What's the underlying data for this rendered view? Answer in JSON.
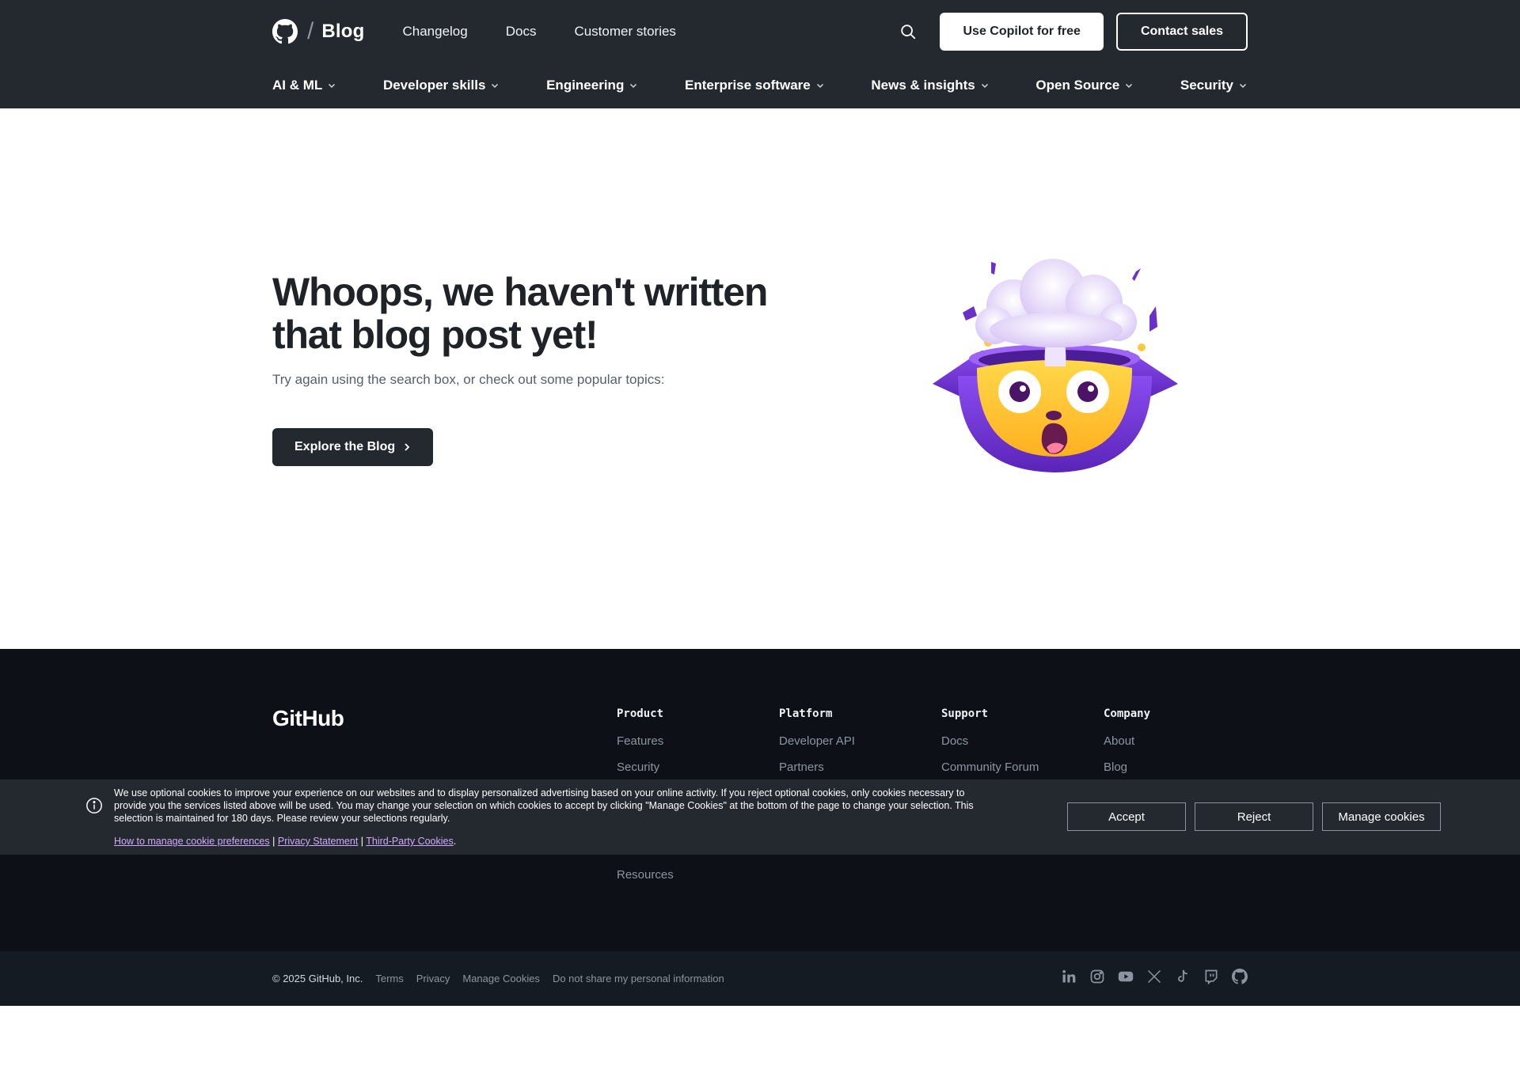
{
  "header": {
    "brand": "Blog",
    "top_links": [
      "Changelog",
      "Docs",
      "Customer stories"
    ],
    "copilot_button": "Use Copilot for free",
    "sales_button": "Contact sales",
    "categories": [
      "AI & ML",
      "Developer skills",
      "Engineering",
      "Enterprise software",
      "News & insights",
      "Open Source",
      "Security"
    ]
  },
  "hero": {
    "title": "Whoops, we haven't written that blog post yet!",
    "subtitle": "Try again using the search box, or check out some popular topics:",
    "button": "Explore the Blog"
  },
  "footer": {
    "logo": "GitHub",
    "columns": [
      {
        "heading": "Product",
        "links": [
          "Features",
          "Security"
        ]
      },
      {
        "heading": "Platform",
        "links": [
          "Developer API",
          "Partners"
        ]
      },
      {
        "heading": "Support",
        "links": [
          "Docs",
          "Community Forum"
        ]
      },
      {
        "heading": "Company",
        "links": [
          "About",
          "Blog"
        ]
      }
    ],
    "extra_link": "Resources",
    "copyright": "© 2025 GitHub, Inc.",
    "legal_links": [
      "Terms",
      "Privacy",
      "Manage Cookies",
      "Do not share my personal information"
    ],
    "social_icons": [
      "linkedin-icon",
      "instagram-icon",
      "youtube-icon",
      "x-icon",
      "tiktok-icon",
      "twitch-icon",
      "github-icon"
    ]
  },
  "cookie": {
    "message": "We use optional cookies to improve your experience on our websites and to display personalized advertising based on your online activity. If you reject optional cookies, only cookies necessary to provide you the services listed above will be used. You may change your selection on which cookies to accept by clicking \"Manage Cookies\" at the bottom of the page to change your selection. This selection is maintained for 180 days. Please review your selections regularly.",
    "link_manage": "How to manage cookie preferences",
    "separator": "|",
    "link_privacy": "Privacy Statement",
    "link_third_party": "Third-Party Cookies",
    "end_period": ".",
    "accept": "Accept",
    "reject": "Reject",
    "manage": "Manage cookies"
  },
  "colors": {
    "header_bg": "#24292f",
    "footer_bg": "#0d1117",
    "subfooter_bg": "#151b23",
    "cookie_bg": "#24292f",
    "link_purple": "#d2a8ff",
    "mascot_purple": "#7b3fe4",
    "mascot_yellow": "#ffc83d"
  }
}
